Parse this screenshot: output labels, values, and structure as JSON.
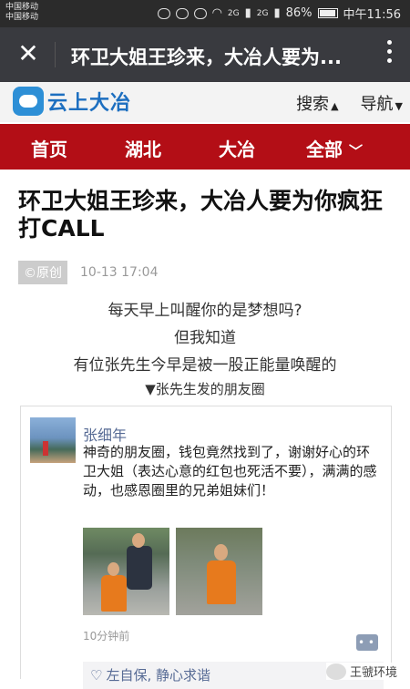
{
  "status_bar": {
    "carriers": [
      "中国移动",
      "中国移动"
    ],
    "signal_labels": [
      "2G",
      "2G"
    ],
    "battery": "86%",
    "time": "中午11:56"
  },
  "wechat_bar": {
    "close_icon": "close-icon",
    "title": "环卫大姐王珍来，大冶人要为..."
  },
  "site_header": {
    "logo_text": "云上大冶",
    "search": "搜索",
    "nav": "导航"
  },
  "red_nav": {
    "tabs": [
      "首页",
      "湖北",
      "大冶",
      "全部"
    ]
  },
  "article": {
    "title": "环卫大姐王珍来，大冶人要为你疯狂打CALL",
    "badge": "©原创",
    "date": "10-13 17:04",
    "lines": [
      "每天早上叫醒你的是梦想吗?",
      "但我知道",
      "有位张先生今早是被一股正能量唤醒的",
      "▼张先生发的朋友圈"
    ]
  },
  "moments_post": {
    "author": "张细年",
    "text": "神奇的朋友圈，钱包竟然找到了，谢谢好心的环卫大姐（表达心意的红包也死活不要），满满的感动，也感恩圈里的兄弟姐妹们！",
    "time_ago": "10分钟前",
    "likes": "左自保, 静心求谐"
  },
  "watermark": "王虢环境"
}
